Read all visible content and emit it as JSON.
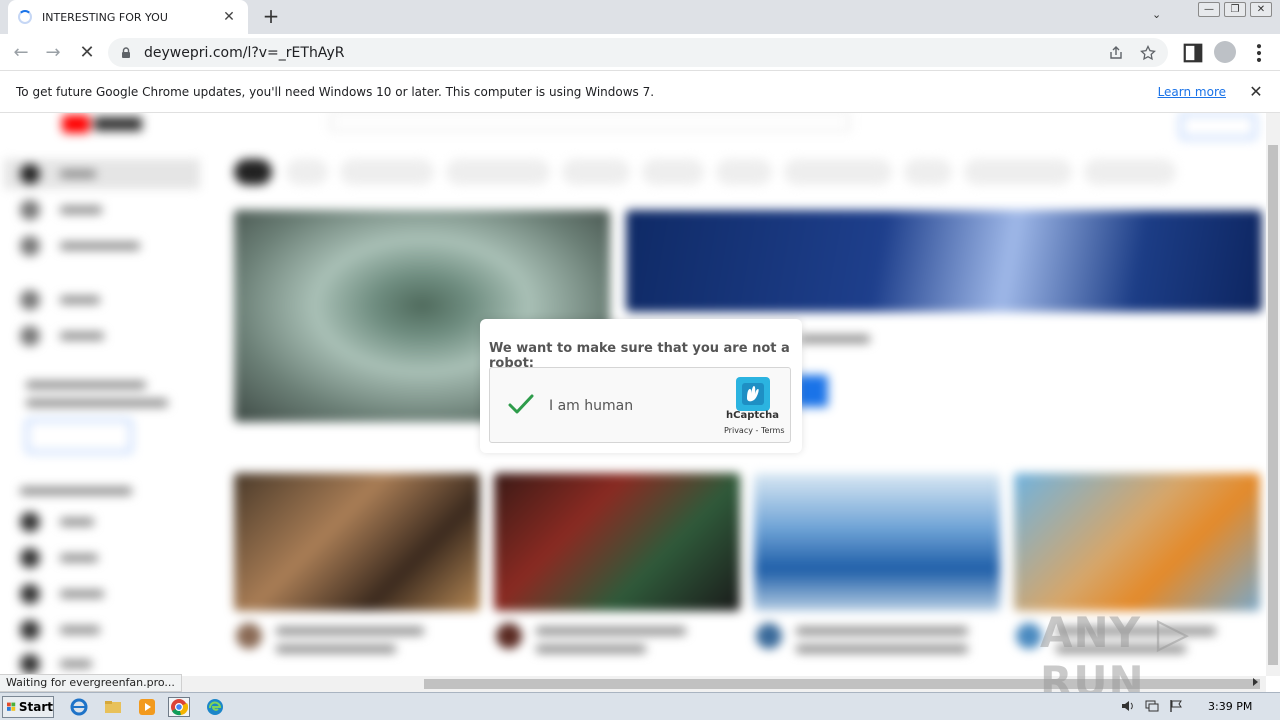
{
  "browser": {
    "tab": {
      "title": "INTERESTING FOR YOU",
      "close": "✕"
    },
    "new_tab": "+",
    "tab_search": "⌄",
    "window_controls": [
      "—",
      "❐",
      "✕"
    ],
    "nav": {
      "back": "←",
      "forward": "→",
      "stop": "✕"
    },
    "url": "deywepri.com/l?v=_rEThAyR",
    "infobar": {
      "message": "To get future Google Chrome updates, you'll need Windows 10 or later. This computer is using Windows 7.",
      "link": "Learn more",
      "close": "✕"
    },
    "status": "Waiting for evergreenfan.pro...",
    "colors": {
      "tabstrip": "#dee1e6",
      "accent": "#1a73e8"
    }
  },
  "captcha": {
    "prompt": "We want to make sure that you are not a robot:",
    "checkbox_label": "I am human",
    "brand": "hCaptcha",
    "links": "Privacy - Terms",
    "check_color": "#2e9c4b"
  },
  "watermark": "ANY ▷ RUN",
  "taskbar": {
    "start": "Start",
    "clock": "3:39 PM",
    "icons": [
      "ie-icon",
      "explorer-icon",
      "media-player-icon",
      "chrome-icon",
      "edge-icon"
    ]
  }
}
